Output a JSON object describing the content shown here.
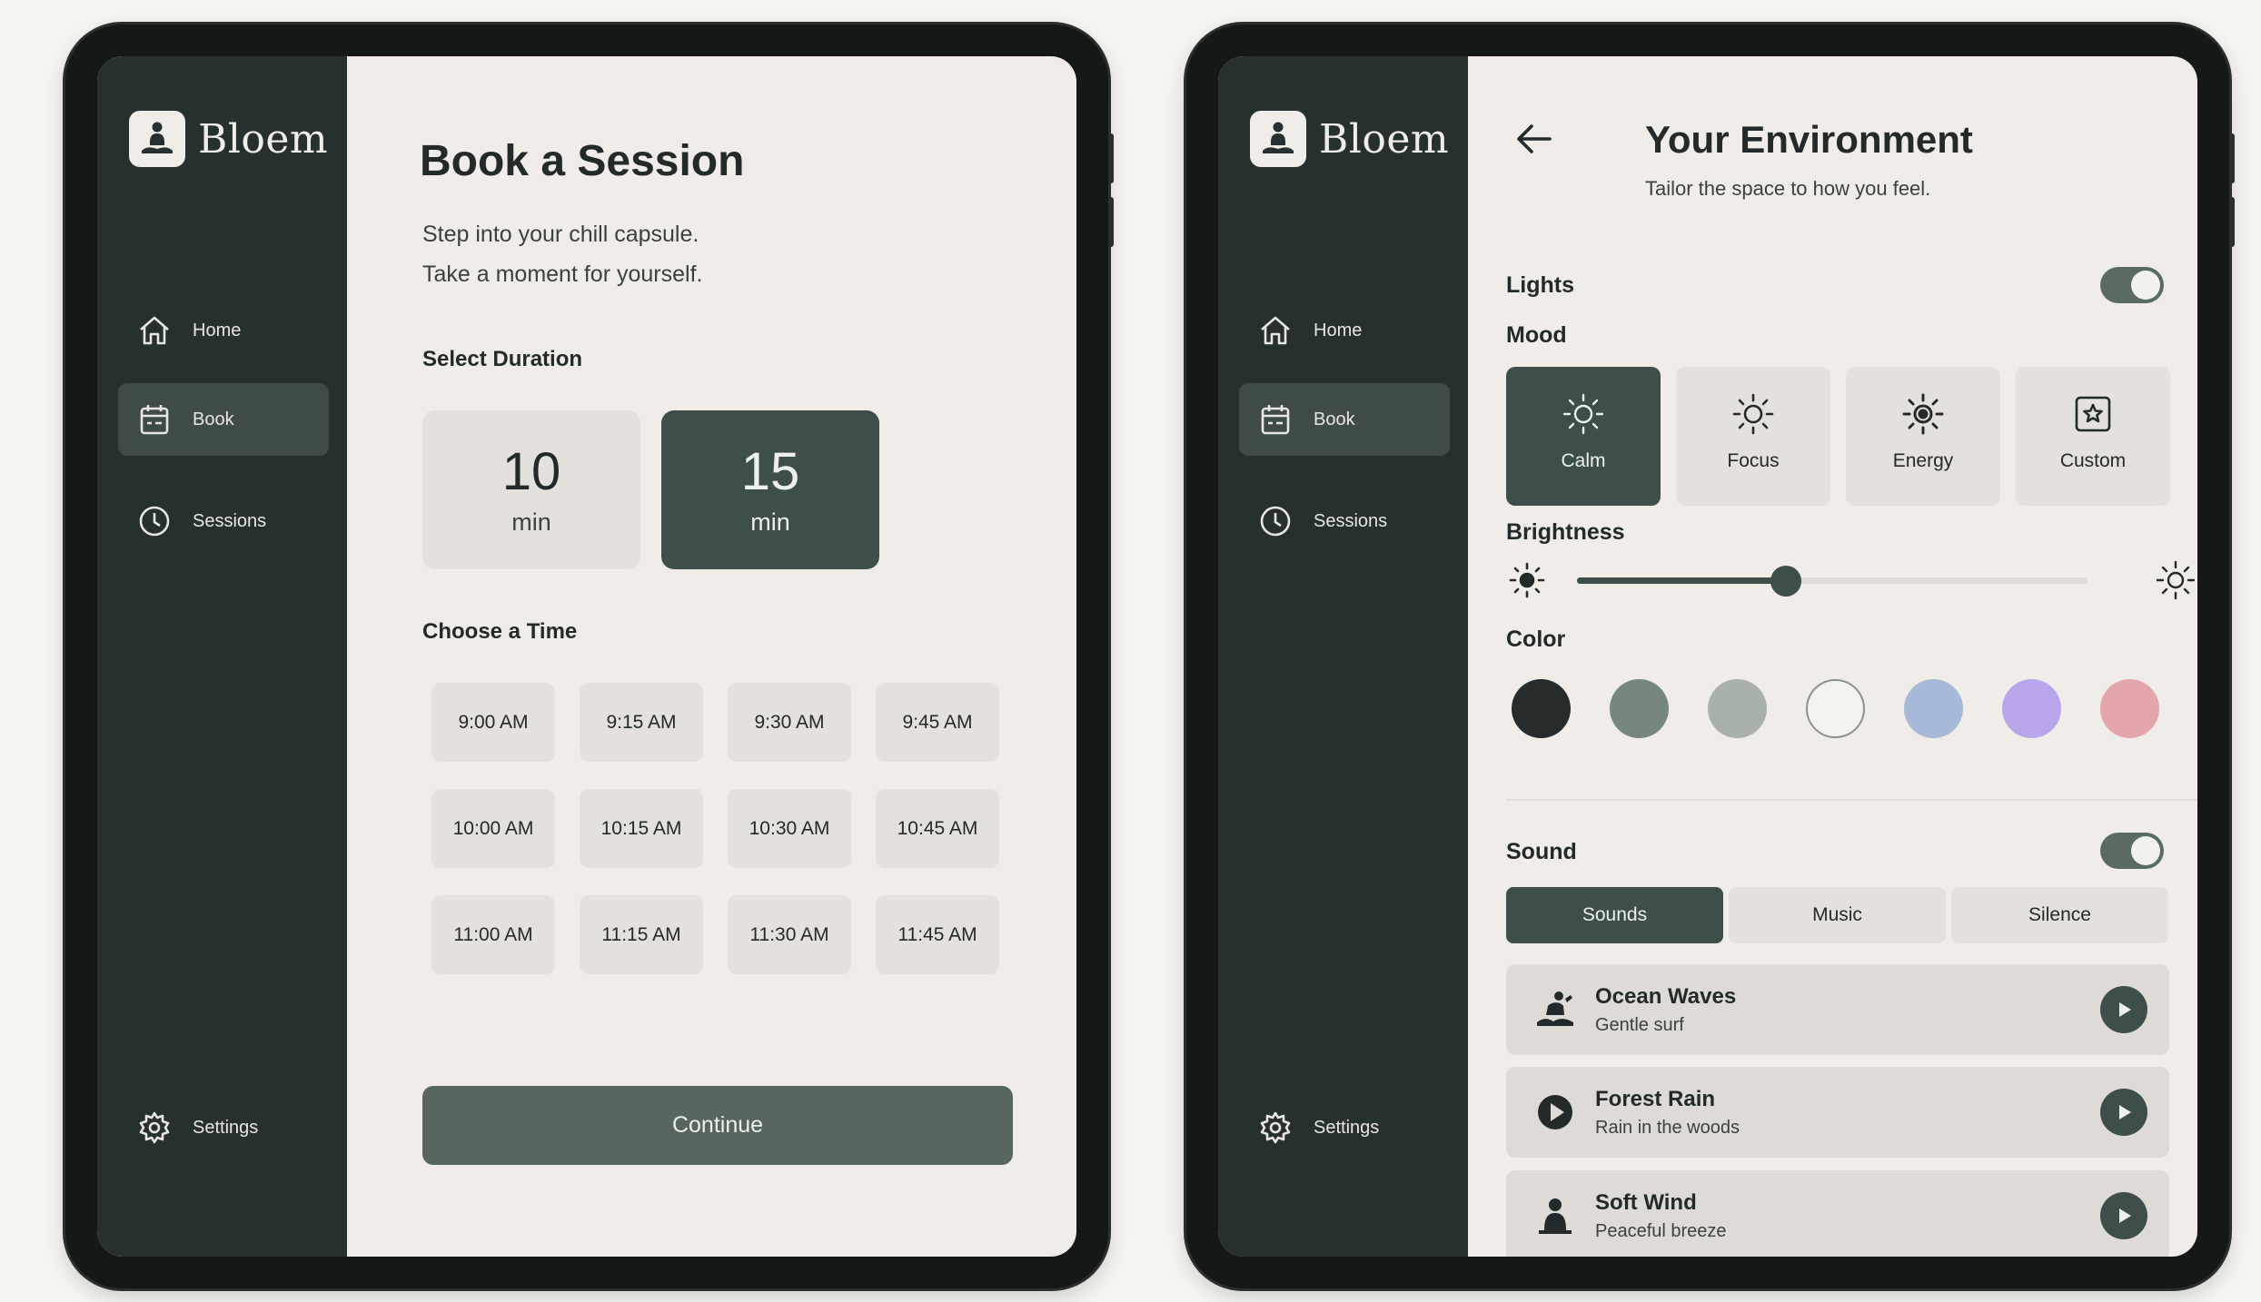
{
  "app": {
    "name": "Bloem"
  },
  "sidebar": {
    "items": [
      {
        "label": "Home"
      },
      {
        "label": "Book"
      },
      {
        "label": "Sessions"
      }
    ],
    "settings_label": "Settings"
  },
  "booking": {
    "title": "Book a Session",
    "subtitle_line1": "Step into your chill capsule.",
    "subtitle_line2": "Take a moment for yourself.",
    "duration_label": "Select Duration",
    "durations": [
      {
        "value": "10",
        "unit": "min",
        "selected": false
      },
      {
        "value": "15",
        "unit": "min",
        "selected": true
      }
    ],
    "time_label": "Choose a Time",
    "times": [
      "9:00 AM",
      "9:15 AM",
      "9:30 AM",
      "9:45 AM",
      "10:00 AM",
      "10:15 AM",
      "10:30 AM",
      "10:45 AM",
      "11:00 AM",
      "11:15 AM",
      "11:30 AM",
      "11:45 AM"
    ],
    "continue_label": "Continue"
  },
  "environment": {
    "title": "Your Environment",
    "subtitle": "Tailor the space to how you feel.",
    "lights_label": "Lights",
    "lights_on": true,
    "mood_label": "Mood",
    "moods": [
      {
        "label": "Calm",
        "icon": "sun-icon",
        "selected": true
      },
      {
        "label": "Focus",
        "icon": "sun-icon",
        "selected": false
      },
      {
        "label": "Energy",
        "icon": "sun-bold-icon",
        "selected": false
      },
      {
        "label": "Custom",
        "icon": "star-square-icon",
        "selected": false
      }
    ],
    "brightness_label": "Brightness",
    "brightness_value": 0.41,
    "color_label": "Color",
    "colors": [
      "#252c2b",
      "#76877d",
      "#a9b2aa",
      "#f4f2ee",
      "#a8b9d8",
      "#b9a6ea",
      "#e4a6ad"
    ],
    "sound_label": "Sound",
    "sound_on": true,
    "sound_tabs": [
      {
        "label": "Sounds",
        "selected": true
      },
      {
        "label": "Music",
        "selected": false
      },
      {
        "label": "Silence",
        "selected": false
      }
    ],
    "tracks": [
      {
        "name": "Ocean Waves",
        "desc": "Gentle surf",
        "icon": "surfer-icon"
      },
      {
        "name": "Forest Rain",
        "desc": "Rain in the woods",
        "icon": "play-circle-icon"
      },
      {
        "name": "Soft Wind",
        "desc": "Peaceful breeze",
        "icon": "person-icon"
      }
    ],
    "accent_color": "#3d4f48"
  }
}
